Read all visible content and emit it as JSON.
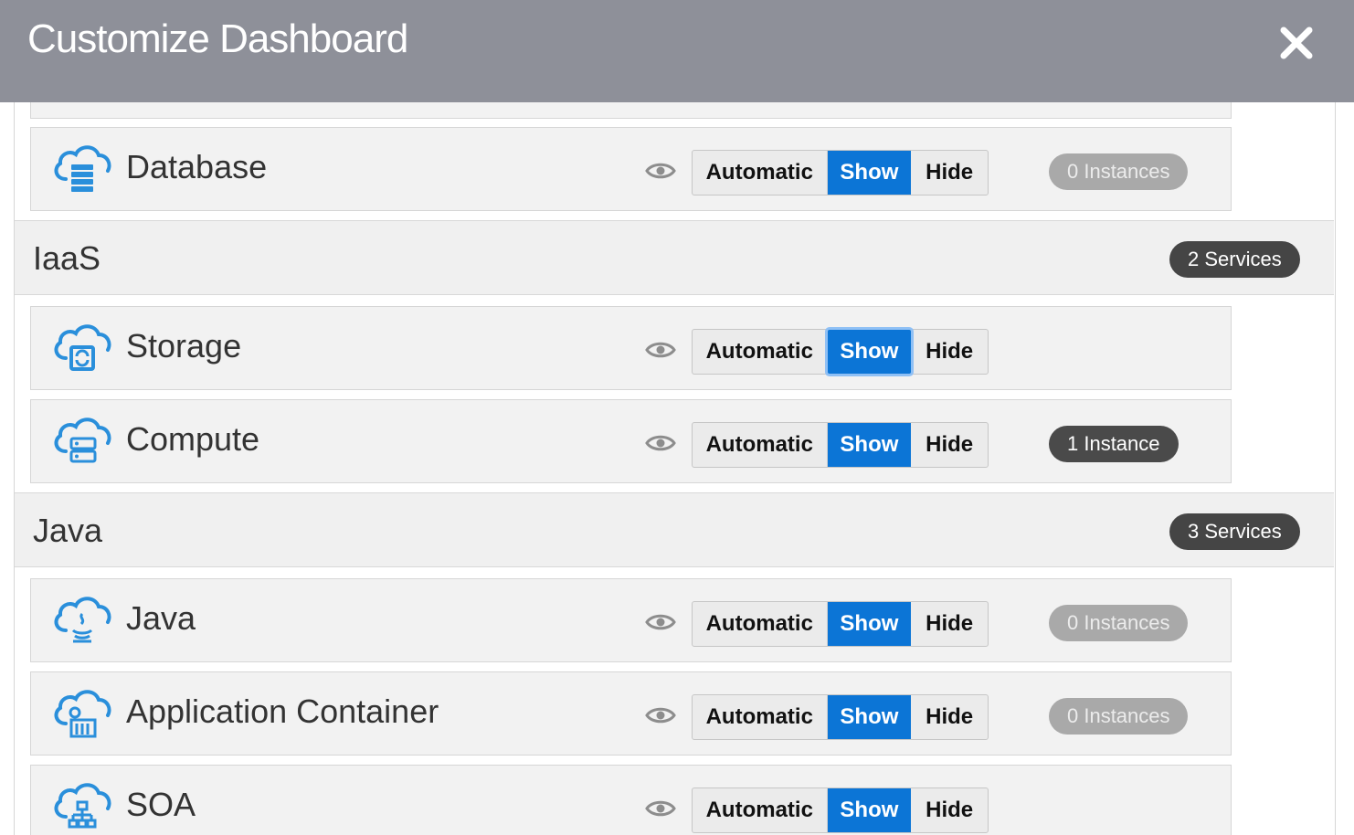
{
  "header": {
    "title": "Customize Dashboard",
    "close_icon": "close-icon"
  },
  "colors": {
    "header_bg": "#8e9099",
    "accent": "#0c75d6",
    "badge_dark": "#4a4a4a",
    "badge_muted": "#a9a9a9"
  },
  "toggle_labels": {
    "automatic": "Automatic",
    "show": "Show",
    "hide": "Hide"
  },
  "rows": {
    "database": {
      "name": "Database",
      "icon": "cloud-database-icon",
      "selected": "Show",
      "instances": "0 Instances"
    },
    "storage": {
      "name": "Storage",
      "icon": "cloud-storage-icon",
      "selected": "Show"
    },
    "compute": {
      "name": "Compute",
      "icon": "cloud-compute-icon",
      "selected": "Show",
      "instances": "1 Instance"
    },
    "java": {
      "name": "Java",
      "icon": "cloud-java-icon",
      "selected": "Show",
      "instances": "0 Instances"
    },
    "appcontainer": {
      "name": "Application Container",
      "icon": "cloud-app-container-icon",
      "selected": "Show",
      "instances": "0 Instances"
    },
    "soa": {
      "name": "SOA",
      "icon": "cloud-soa-icon",
      "selected": "Show"
    }
  },
  "groups": {
    "iaas": {
      "title": "IaaS",
      "badge": "2 Services"
    },
    "java": {
      "title": "Java",
      "badge": "3 Services"
    }
  }
}
